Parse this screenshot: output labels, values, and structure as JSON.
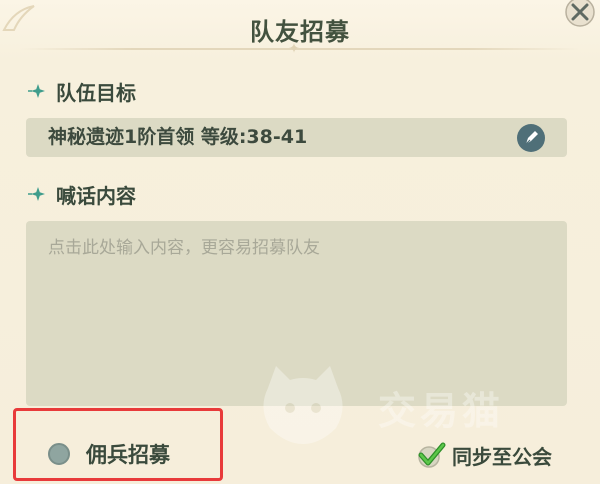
{
  "dialog": {
    "title": "队友招募",
    "team_goal": {
      "label": "队伍目标",
      "value": "神秘遗迹1阶首领 等级:38-41"
    },
    "message": {
      "label": "喊话内容",
      "placeholder": "点击此处输入内容，更容易招募队友",
      "value": ""
    },
    "mercenary": {
      "label": "佣兵招募",
      "checked": false
    },
    "sync_guild": {
      "label": "同步至公会",
      "checked": true
    }
  },
  "watermark": {
    "text": "交易猫"
  },
  "colors": {
    "accent_teal": "#3f9d8c",
    "highlight_red": "#e83a3a",
    "panel": "#dcdac4",
    "check_green": "#4caf3a"
  },
  "icons": {
    "close": "close-icon",
    "edit": "pen-icon",
    "section": "sparkle-icon",
    "check": "check-icon"
  }
}
